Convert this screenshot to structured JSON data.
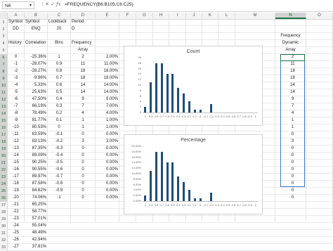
{
  "namebox": "N6",
  "formula": "=FREQUENCY(B6:B105,C6:C25)",
  "fx_label": "fx",
  "columns": [
    "A",
    "B",
    "C",
    "D",
    "E",
    "F",
    "G",
    "H",
    "I",
    "J",
    "K",
    "L",
    "M",
    "N",
    "O"
  ],
  "row_numbers": [
    "1",
    "2",
    "3",
    "4",
    "5",
    "6",
    "7",
    "8",
    "9",
    "10",
    "11",
    "12",
    "13",
    "14",
    "15",
    "16",
    "17",
    "18",
    "19",
    "20",
    "21",
    "22",
    "23",
    "24",
    "25",
    "26",
    "27",
    "28",
    "29",
    "30",
    "31",
    "32",
    "33"
  ],
  "headers": {
    "a1": "Symbol",
    "a2": "DD",
    "b1": "Symbol",
    "b2": "ENQ",
    "c1": "Lookback",
    "c2": "20",
    "d1": "Period",
    "d2": "D",
    "a4": "History",
    "b4": "Correlation",
    "c4": "Bins",
    "d4": "Frequency",
    "d5": "Array",
    "n3": "Frequency",
    "n4": "Dynamic",
    "n5": "Array"
  },
  "col_a": [
    "0",
    "-1",
    "-2",
    "-3",
    "-4",
    "-5",
    "-6",
    "-7",
    "-8",
    "-9",
    "-10",
    "-11",
    "-12",
    "-13",
    "-14",
    "-15",
    "-16",
    "-17",
    "-18",
    "-19",
    "-20",
    "-21",
    "-22",
    "-23",
    "-24",
    "-25",
    "-26",
    "-27"
  ],
  "col_b": [
    "-25.36%",
    "-28.07%",
    "-28.27%",
    "-9.96%",
    "5.33%",
    "25.63%",
    "47.50%",
    "66.19%",
    "78.49%",
    "81.77%",
    "80.53%",
    "83.59%",
    "83.13%",
    "87.35%",
    "89.09%",
    "90.25%",
    "90.55%",
    "89.97%",
    "87.58%",
    "84.62%",
    "74.06%",
    "65.25%",
    "58.77%",
    "57.01%",
    "55.04%",
    "48.49%",
    "42.94%",
    "37.81%"
  ],
  "col_c": [
    "1",
    "0.9",
    "0.8",
    "0.7",
    "0.6",
    "0.5",
    "0.4",
    "0.3",
    "0.2",
    "0.1",
    "0",
    "-0.1",
    "-0.2",
    "-0.3",
    "-0.4",
    "-0.5",
    "-0.6",
    "-0.7",
    "-0.8",
    "-0.9",
    "-1"
  ],
  "col_d": [
    "2",
    "11",
    "18",
    "18",
    "14",
    "14",
    "9",
    "7",
    "4",
    "1",
    "1",
    "0",
    "3",
    "0",
    "0",
    "0",
    "0",
    "0",
    "0",
    "0",
    "0"
  ],
  "col_e": [
    "2.00%",
    "11.00%",
    "18.00%",
    "18.00%",
    "14.00%",
    "14.00%",
    "9.00%",
    "7.00%",
    "4.00%",
    "1.00%",
    "1.00%",
    "0.00%",
    "3.00%",
    "0.00%",
    "0.00%",
    "0.00%",
    "0.00%",
    "0.00%",
    "0.00%",
    "0.00%",
    "0.00%"
  ],
  "col_n": [
    "2",
    "11",
    "18",
    "18",
    "14",
    "14",
    "9",
    "7",
    "4",
    "1",
    "1",
    "0",
    "3",
    "0",
    "0",
    "0",
    "0",
    "0",
    "0",
    "0",
    "0"
  ],
  "chart_data": [
    {
      "type": "bar",
      "title": "Count",
      "categories": [
        "1",
        "0.9",
        "0.8",
        "0.7",
        "0.6",
        "0.5",
        "0.4",
        "0.3",
        "0.2",
        "0.1",
        "0",
        "-0.1",
        "-0.2",
        "-0.3",
        "-0.4",
        "-0.5",
        "-0.6",
        "-0.7",
        "-0.8",
        "-0.9",
        "-1"
      ],
      "values": [
        2,
        11,
        18,
        18,
        14,
        14,
        9,
        7,
        4,
        1,
        1,
        0,
        3,
        0,
        0,
        0,
        0,
        0,
        0,
        0,
        0
      ],
      "yticks": [
        "0",
        "2",
        "4",
        "6",
        "8",
        "10",
        "12",
        "14",
        "16",
        "18",
        "20"
      ],
      "ylim": [
        0,
        20
      ],
      "color": "#1f4e79"
    },
    {
      "type": "bar",
      "title": "Percentage",
      "categories": [
        "1",
        "0.9",
        "0.8",
        "0.7",
        "0.6",
        "0.5",
        "0.4",
        "0.3",
        "0.2",
        "0.1",
        "0",
        "-0.1",
        "-0.2",
        "-0.3",
        "-0.4",
        "-0.5",
        "-0.6",
        "-0.7",
        "-0.8",
        "-0.9",
        "-1"
      ],
      "values": [
        2,
        11,
        18,
        18,
        14,
        14,
        9,
        7,
        4,
        1,
        1,
        0,
        3,
        0,
        0,
        0,
        0,
        0,
        0,
        0,
        0
      ],
      "yticks": [
        "0.00%",
        "2.00%",
        "4.00%",
        "6.00%",
        "8.00%",
        "10.00%",
        "12.00%",
        "14.00%",
        "16.00%",
        "18.00%",
        "20.00%"
      ],
      "ylim": [
        0,
        20
      ],
      "color": "#1f4e79"
    }
  ]
}
